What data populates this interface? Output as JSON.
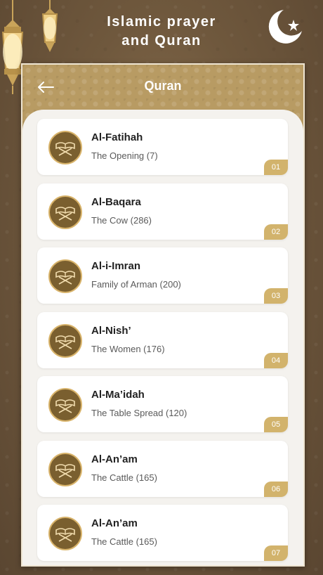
{
  "app": {
    "title_line1": "Islamic prayer",
    "title_line2": "and Quran"
  },
  "header": {
    "title": "Quran",
    "back_icon": "arrow-left-icon"
  },
  "colors": {
    "gold": "#d2b36c",
    "brown": "#7a5f2f",
    "header_bg": "#b89b63"
  },
  "surahs": [
    {
      "name": "Al-Fatihah",
      "subtitle": "The Opening (7)",
      "number": "01"
    },
    {
      "name": "Al-Baqara",
      "subtitle": "The Cow (286)",
      "number": "02"
    },
    {
      "name": "Al-i-Imran",
      "subtitle": "Family of Arman (200)",
      "number": "03"
    },
    {
      "name": "Al-Nish’",
      "subtitle": "The Women (176)",
      "number": "04"
    },
    {
      "name": "Al-Ma’idah",
      "subtitle": "The Table Spread (120)",
      "number": "05"
    },
    {
      "name": "Al-An’am",
      "subtitle": "The Cattle (165)",
      "number": "06"
    },
    {
      "name": "Al-An’am",
      "subtitle": "The Cattle (165)",
      "number": "07"
    }
  ]
}
